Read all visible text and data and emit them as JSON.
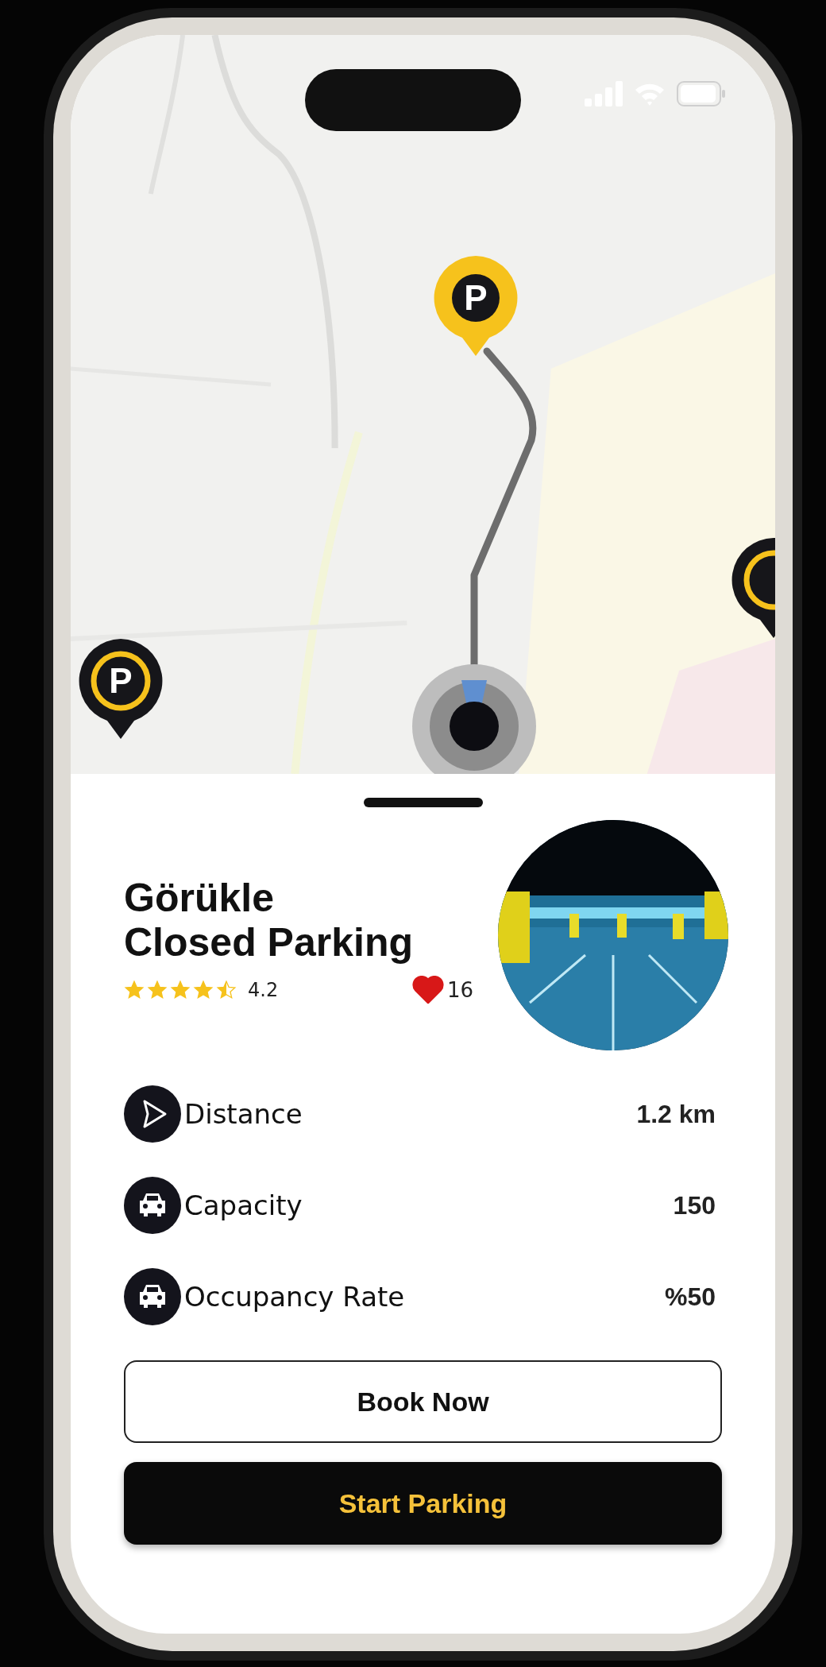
{
  "map": {
    "pins": [
      {
        "kind": "selected",
        "label": "P"
      },
      {
        "kind": "default",
        "label": "P"
      },
      {
        "kind": "edge"
      }
    ]
  },
  "place": {
    "title": "Görükle\nClosed Parking",
    "stars": 4.5,
    "rating": "4.2",
    "liked": true,
    "likes": "16"
  },
  "details": [
    {
      "kind": "distance",
      "label": "Distance",
      "value": "1.2 km"
    },
    {
      "kind": "capacity",
      "label": "Capacity",
      "value": "150"
    },
    {
      "kind": "occupancy",
      "label": "Occupancy Rate",
      "value": "%50"
    }
  ],
  "buttons": [
    {
      "kind": "outline",
      "label": "Book Now"
    },
    {
      "kind": "primary",
      "label": "Start Parking"
    }
  ]
}
